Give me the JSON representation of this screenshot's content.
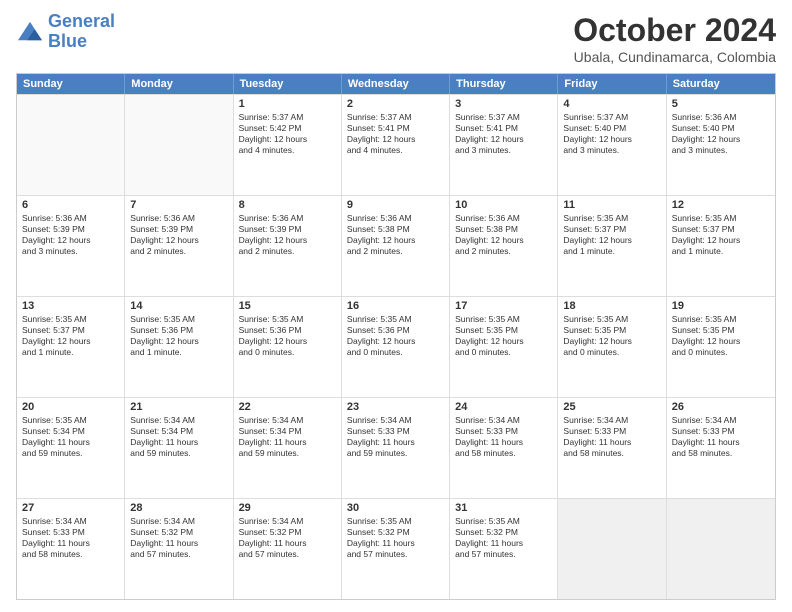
{
  "logo": {
    "line1": "General",
    "line2": "Blue"
  },
  "title": "October 2024",
  "location": "Ubala, Cundinamarca, Colombia",
  "headers": [
    "Sunday",
    "Monday",
    "Tuesday",
    "Wednesday",
    "Thursday",
    "Friday",
    "Saturday"
  ],
  "rows": [
    [
      {
        "day": "",
        "text": "",
        "empty": true
      },
      {
        "day": "",
        "text": "",
        "empty": true
      },
      {
        "day": "1",
        "text": "Sunrise: 5:37 AM\nSunset: 5:42 PM\nDaylight: 12 hours\nand 4 minutes.",
        "empty": false
      },
      {
        "day": "2",
        "text": "Sunrise: 5:37 AM\nSunset: 5:41 PM\nDaylight: 12 hours\nand 4 minutes.",
        "empty": false
      },
      {
        "day": "3",
        "text": "Sunrise: 5:37 AM\nSunset: 5:41 PM\nDaylight: 12 hours\nand 3 minutes.",
        "empty": false
      },
      {
        "day": "4",
        "text": "Sunrise: 5:37 AM\nSunset: 5:40 PM\nDaylight: 12 hours\nand 3 minutes.",
        "empty": false
      },
      {
        "day": "5",
        "text": "Sunrise: 5:36 AM\nSunset: 5:40 PM\nDaylight: 12 hours\nand 3 minutes.",
        "empty": false
      }
    ],
    [
      {
        "day": "6",
        "text": "Sunrise: 5:36 AM\nSunset: 5:39 PM\nDaylight: 12 hours\nand 3 minutes.",
        "empty": false
      },
      {
        "day": "7",
        "text": "Sunrise: 5:36 AM\nSunset: 5:39 PM\nDaylight: 12 hours\nand 2 minutes.",
        "empty": false
      },
      {
        "day": "8",
        "text": "Sunrise: 5:36 AM\nSunset: 5:39 PM\nDaylight: 12 hours\nand 2 minutes.",
        "empty": false
      },
      {
        "day": "9",
        "text": "Sunrise: 5:36 AM\nSunset: 5:38 PM\nDaylight: 12 hours\nand 2 minutes.",
        "empty": false
      },
      {
        "day": "10",
        "text": "Sunrise: 5:36 AM\nSunset: 5:38 PM\nDaylight: 12 hours\nand 2 minutes.",
        "empty": false
      },
      {
        "day": "11",
        "text": "Sunrise: 5:35 AM\nSunset: 5:37 PM\nDaylight: 12 hours\nand 1 minute.",
        "empty": false
      },
      {
        "day": "12",
        "text": "Sunrise: 5:35 AM\nSunset: 5:37 PM\nDaylight: 12 hours\nand 1 minute.",
        "empty": false
      }
    ],
    [
      {
        "day": "13",
        "text": "Sunrise: 5:35 AM\nSunset: 5:37 PM\nDaylight: 12 hours\nand 1 minute.",
        "empty": false
      },
      {
        "day": "14",
        "text": "Sunrise: 5:35 AM\nSunset: 5:36 PM\nDaylight: 12 hours\nand 1 minute.",
        "empty": false
      },
      {
        "day": "15",
        "text": "Sunrise: 5:35 AM\nSunset: 5:36 PM\nDaylight: 12 hours\nand 0 minutes.",
        "empty": false
      },
      {
        "day": "16",
        "text": "Sunrise: 5:35 AM\nSunset: 5:36 PM\nDaylight: 12 hours\nand 0 minutes.",
        "empty": false
      },
      {
        "day": "17",
        "text": "Sunrise: 5:35 AM\nSunset: 5:35 PM\nDaylight: 12 hours\nand 0 minutes.",
        "empty": false
      },
      {
        "day": "18",
        "text": "Sunrise: 5:35 AM\nSunset: 5:35 PM\nDaylight: 12 hours\nand 0 minutes.",
        "empty": false
      },
      {
        "day": "19",
        "text": "Sunrise: 5:35 AM\nSunset: 5:35 PM\nDaylight: 12 hours\nand 0 minutes.",
        "empty": false
      }
    ],
    [
      {
        "day": "20",
        "text": "Sunrise: 5:35 AM\nSunset: 5:34 PM\nDaylight: 11 hours\nand 59 minutes.",
        "empty": false
      },
      {
        "day": "21",
        "text": "Sunrise: 5:34 AM\nSunset: 5:34 PM\nDaylight: 11 hours\nand 59 minutes.",
        "empty": false
      },
      {
        "day": "22",
        "text": "Sunrise: 5:34 AM\nSunset: 5:34 PM\nDaylight: 11 hours\nand 59 minutes.",
        "empty": false
      },
      {
        "day": "23",
        "text": "Sunrise: 5:34 AM\nSunset: 5:33 PM\nDaylight: 11 hours\nand 59 minutes.",
        "empty": false
      },
      {
        "day": "24",
        "text": "Sunrise: 5:34 AM\nSunset: 5:33 PM\nDaylight: 11 hours\nand 58 minutes.",
        "empty": false
      },
      {
        "day": "25",
        "text": "Sunrise: 5:34 AM\nSunset: 5:33 PM\nDaylight: 11 hours\nand 58 minutes.",
        "empty": false
      },
      {
        "day": "26",
        "text": "Sunrise: 5:34 AM\nSunset: 5:33 PM\nDaylight: 11 hours\nand 58 minutes.",
        "empty": false
      }
    ],
    [
      {
        "day": "27",
        "text": "Sunrise: 5:34 AM\nSunset: 5:33 PM\nDaylight: 11 hours\nand 58 minutes.",
        "empty": false
      },
      {
        "day": "28",
        "text": "Sunrise: 5:34 AM\nSunset: 5:32 PM\nDaylight: 11 hours\nand 57 minutes.",
        "empty": false
      },
      {
        "day": "29",
        "text": "Sunrise: 5:34 AM\nSunset: 5:32 PM\nDaylight: 11 hours\nand 57 minutes.",
        "empty": false
      },
      {
        "day": "30",
        "text": "Sunrise: 5:35 AM\nSunset: 5:32 PM\nDaylight: 11 hours\nand 57 minutes.",
        "empty": false
      },
      {
        "day": "31",
        "text": "Sunrise: 5:35 AM\nSunset: 5:32 PM\nDaylight: 11 hours\nand 57 minutes.",
        "empty": false
      },
      {
        "day": "",
        "text": "",
        "empty": true,
        "shaded": true
      },
      {
        "day": "",
        "text": "",
        "empty": true,
        "shaded": true
      }
    ]
  ]
}
